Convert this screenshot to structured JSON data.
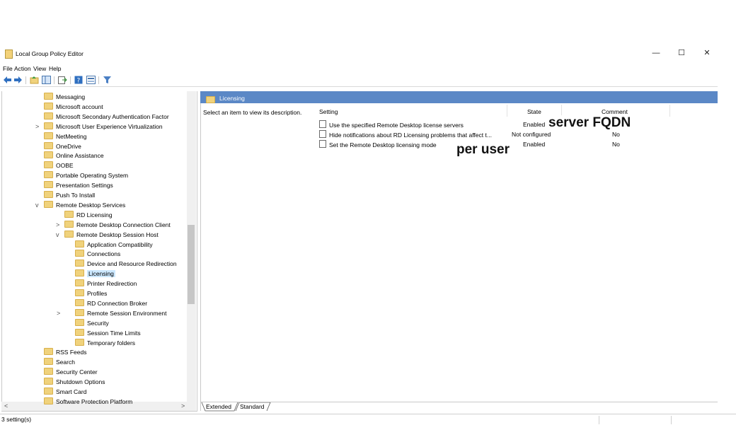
{
  "window": {
    "title": "Local Group Policy Editor",
    "controls": {
      "minimize": "—",
      "maximize": "☐",
      "close": "✕"
    }
  },
  "menu": [
    "File",
    "Action",
    "View",
    "Help"
  ],
  "toolbar": {
    "icons": [
      "back-arrow-icon",
      "forward-arrow-icon",
      "up-folder-icon",
      "show-tree-icon",
      "export-list-icon",
      "help-icon",
      "properties-icon",
      "filter-icon"
    ]
  },
  "tree": {
    "items": [
      {
        "label": "Messaging",
        "level": 0,
        "expander": ""
      },
      {
        "label": "Microsoft account",
        "level": 0,
        "expander": ""
      },
      {
        "label": "Microsoft Secondary Authentication Factor",
        "level": 0,
        "expander": ""
      },
      {
        "label": "Microsoft User Experience Virtualization",
        "level": 0,
        "expander": ">"
      },
      {
        "label": "NetMeeting",
        "level": 0,
        "expander": ""
      },
      {
        "label": "OneDrive",
        "level": 0,
        "expander": ""
      },
      {
        "label": "Online Assistance",
        "level": 0,
        "expander": ""
      },
      {
        "label": "OOBE",
        "level": 0,
        "expander": ""
      },
      {
        "label": "Portable Operating System",
        "level": 0,
        "expander": ""
      },
      {
        "label": "Presentation Settings",
        "level": 0,
        "expander": ""
      },
      {
        "label": "Push To Install",
        "level": 0,
        "expander": ""
      },
      {
        "label": "Remote Desktop Services",
        "level": 0,
        "expander": "v"
      },
      {
        "label": "RD Licensing",
        "level": 1,
        "expander": ""
      },
      {
        "label": "Remote Desktop Connection Client",
        "level": 1,
        "expander": ">"
      },
      {
        "label": "Remote Desktop Session Host",
        "level": 1,
        "expander": "v"
      },
      {
        "label": "Application Compatibility",
        "level": 2,
        "expander": ""
      },
      {
        "label": "Connections",
        "level": 2,
        "expander": ""
      },
      {
        "label": "Device and Resource Redirection",
        "level": 2,
        "expander": ""
      },
      {
        "label": "Licensing",
        "level": 2,
        "expander": "",
        "selected": true
      },
      {
        "label": "Printer Redirection",
        "level": 2,
        "expander": ""
      },
      {
        "label": "Profiles",
        "level": 2,
        "expander": ""
      },
      {
        "label": "RD Connection Broker",
        "level": 2,
        "expander": ""
      },
      {
        "label": "Remote Session Environment",
        "level": 2,
        "expander": ">"
      },
      {
        "label": "Security",
        "level": 2,
        "expander": ""
      },
      {
        "label": "Session Time Limits",
        "level": 2,
        "expander": ""
      },
      {
        "label": "Temporary folders",
        "level": 2,
        "expander": ""
      },
      {
        "label": "RSS Feeds",
        "level": 0,
        "expander": ""
      },
      {
        "label": "Search",
        "level": 0,
        "expander": ""
      },
      {
        "label": "Security Center",
        "level": 0,
        "expander": ""
      },
      {
        "label": "Shutdown Options",
        "level": 0,
        "expander": ""
      },
      {
        "label": "Smart Card",
        "level": 0,
        "expander": ""
      },
      {
        "label": "Software Protection Platform",
        "level": 0,
        "expander": ""
      }
    ],
    "scroll_up": "^",
    "scroll_down": "v",
    "scroll_left": "<",
    "scroll_right": ">"
  },
  "details": {
    "header": "Licensing",
    "description": "Select an item to view its description.",
    "columns": {
      "setting": "Setting",
      "state": "State",
      "comment": "Comment"
    },
    "rows": [
      {
        "setting": "Use the specified Remote Desktop license servers",
        "state": "Enabled",
        "comment": ""
      },
      {
        "setting": "Hide notifications about RD Licensing problems that affect t...",
        "state": "Not configured",
        "comment": "No"
      },
      {
        "setting": "Set the Remote Desktop licensing mode",
        "state": "Enabled",
        "comment": "No"
      }
    ],
    "overlays": {
      "server": "server FQDN",
      "mode": "per user"
    },
    "tabs": [
      "Extended",
      "Standard"
    ]
  },
  "status": {
    "text": "3 setting(s)"
  }
}
